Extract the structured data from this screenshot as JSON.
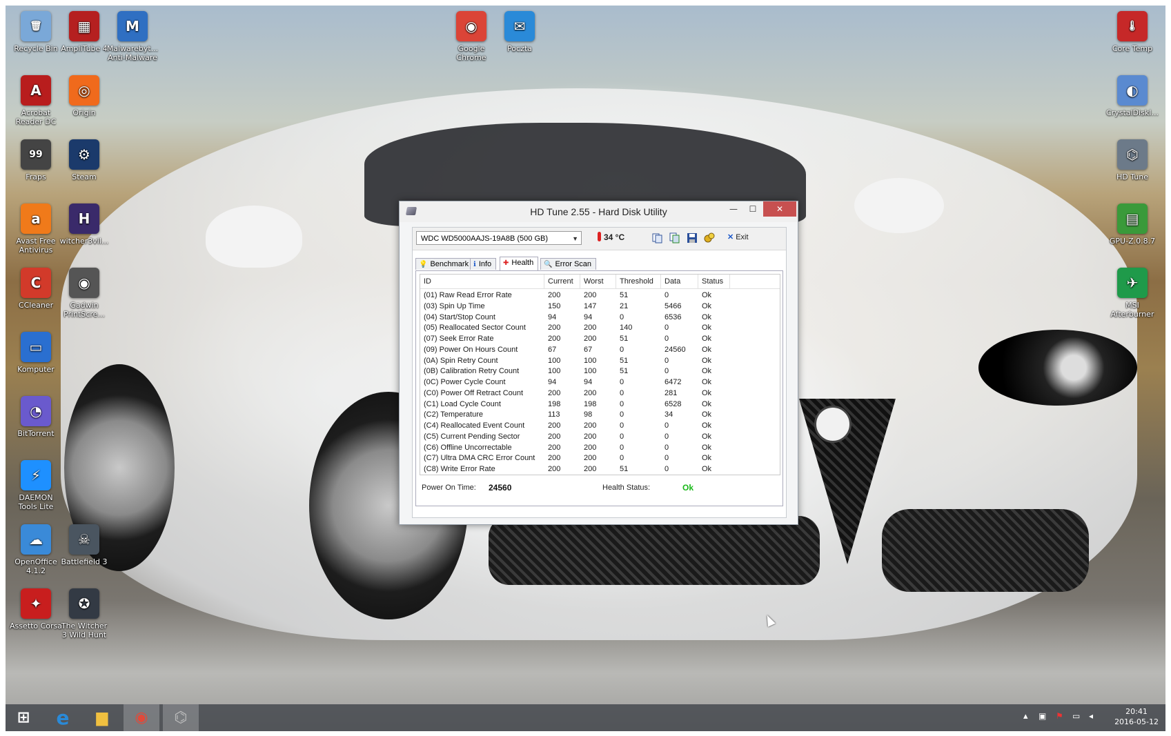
{
  "desktop": {
    "icons_left": [
      {
        "label": "Recycle Bin",
        "icon": "recycle-bin-icon",
        "color": "#7aa8d8",
        "glyph": "🗑"
      },
      {
        "label": "AmpliTube 4",
        "icon": "amplitube-icon",
        "color": "#b52020",
        "glyph": "▦"
      },
      {
        "label": "Malwarebyt... Anti-Malware",
        "icon": "malwarebytes-icon",
        "color": "#2f6fc2",
        "glyph": "M"
      },
      {
        "label": "Acrobat Reader DC",
        "icon": "acrobat-icon",
        "color": "#b81d1d",
        "glyph": "A"
      },
      {
        "label": "Origin",
        "icon": "origin-icon",
        "color": "#f06a1c",
        "glyph": "◎"
      },
      {
        "label": "Fraps",
        "icon": "fraps-icon",
        "color": "#444444",
        "glyph": "99"
      },
      {
        "label": "Steam",
        "icon": "steam-icon",
        "color": "#1b3a6b",
        "glyph": "⚙"
      },
      {
        "label": "Avast Free Antivirus",
        "icon": "avast-icon",
        "color": "#f07a1a",
        "glyph": "a"
      },
      {
        "label": "witcher3vil...",
        "icon": "witcher-hoc-icon",
        "color": "#3a2a6a",
        "glyph": "H"
      },
      {
        "label": "CCleaner",
        "icon": "ccleaner-icon",
        "color": "#d23a2a",
        "glyph": "C"
      },
      {
        "label": "Gadwin PrintScre...",
        "icon": "camera-icon",
        "color": "#555555",
        "glyph": "◉"
      },
      {
        "label": "Komputer",
        "icon": "computer-icon",
        "color": "#2a6fd0",
        "glyph": "▭"
      },
      {
        "label": "BitTorrent",
        "icon": "bittorrent-icon",
        "color": "#6a5acd",
        "glyph": "◔"
      },
      {
        "label": "DAEMON Tools Lite",
        "icon": "daemon-tools-icon",
        "color": "#1e90ff",
        "glyph": "⚡"
      },
      {
        "label": "OpenOffice 4.1.2",
        "icon": "openoffice-icon",
        "color": "#3a8ad8",
        "glyph": "☁"
      },
      {
        "label": "Battlefield 3",
        "icon": "battlefield-icon",
        "color": "#4a5560",
        "glyph": "☠"
      },
      {
        "label": "Assetto Corsa",
        "icon": "assetto-corsa-icon",
        "color": "#c81e1e",
        "glyph": "✦"
      },
      {
        "label": "The Witcher 3 Wild Hunt",
        "icon": "witcher-icon",
        "color": "#333a44",
        "glyph": "✪"
      }
    ],
    "icons_top": [
      {
        "label": "Google Chrome",
        "icon": "chrome-icon",
        "color": "#db4437",
        "glyph": "◉"
      },
      {
        "label": "Poczta",
        "icon": "mail-icon",
        "color": "#2a8ad8",
        "glyph": "✉"
      }
    ],
    "icons_right": [
      {
        "label": "Core Temp",
        "icon": "core-temp-icon",
        "color": "#c62828",
        "glyph": "🌡"
      },
      {
        "label": "CrystalDiskI...",
        "icon": "crystaldiskinfo-icon",
        "color": "#5a8ad0",
        "glyph": "◐"
      },
      {
        "label": "HD Tune",
        "icon": "hd-tune-icon",
        "color": "#6c7a89",
        "glyph": "⌬"
      },
      {
        "label": "GPU-Z.0.8.7",
        "icon": "gpu-z-icon",
        "color": "#3a9a3a",
        "glyph": "▤"
      },
      {
        "label": "MSI Afterburner",
        "icon": "msi-afterburner-icon",
        "color": "#1f9a4a",
        "glyph": "✈"
      }
    ]
  },
  "window": {
    "title": "HD Tune 2.55 - Hard Disk Utility",
    "drive": "WDC    WD5000AAJS-19A8B (500 GB)",
    "temperature": "34 °C",
    "exit_label": "Exit",
    "tabs": [
      {
        "label": "Benchmark",
        "icon": "benchmark-icon",
        "glyph": "💡"
      },
      {
        "label": "Info",
        "icon": "info-icon",
        "glyph": "ℹ"
      },
      {
        "label": "Health",
        "icon": "health-icon",
        "glyph": "✚"
      },
      {
        "label": "Error Scan",
        "icon": "error-scan-icon",
        "glyph": "🔍"
      }
    ],
    "selected_tab": "Health",
    "columns": [
      "ID",
      "Current",
      "Worst",
      "Threshold",
      "Data",
      "Status"
    ],
    "rows": [
      [
        "(01) Raw Read Error Rate",
        "200",
        "200",
        "51",
        "0",
        "Ok"
      ],
      [
        "(03) Spin Up Time",
        "150",
        "147",
        "21",
        "5466",
        "Ok"
      ],
      [
        "(04) Start/Stop Count",
        "94",
        "94",
        "0",
        "6536",
        "Ok"
      ],
      [
        "(05) Reallocated Sector Count",
        "200",
        "200",
        "140",
        "0",
        "Ok"
      ],
      [
        "(07) Seek Error Rate",
        "200",
        "200",
        "51",
        "0",
        "Ok"
      ],
      [
        "(09) Power On Hours Count",
        "67",
        "67",
        "0",
        "24560",
        "Ok"
      ],
      [
        "(0A) Spin Retry Count",
        "100",
        "100",
        "51",
        "0",
        "Ok"
      ],
      [
        "(0B) Calibration Retry Count",
        "100",
        "100",
        "51",
        "0",
        "Ok"
      ],
      [
        "(0C) Power Cycle Count",
        "94",
        "94",
        "0",
        "6472",
        "Ok"
      ],
      [
        "(C0) Power Off Retract Count",
        "200",
        "200",
        "0",
        "281",
        "Ok"
      ],
      [
        "(C1) Load Cycle Count",
        "198",
        "198",
        "0",
        "6528",
        "Ok"
      ],
      [
        "(C2) Temperature",
        "113",
        "98",
        "0",
        "34",
        "Ok"
      ],
      [
        "(C4) Reallocated Event Count",
        "200",
        "200",
        "0",
        "0",
        "Ok"
      ],
      [
        "(C5) Current Pending Sector",
        "200",
        "200",
        "0",
        "0",
        "Ok"
      ],
      [
        "(C6) Offline Uncorrectable",
        "200",
        "200",
        "0",
        "0",
        "Ok"
      ],
      [
        "(C7) Ultra DMA CRC Error Count",
        "200",
        "200",
        "0",
        "0",
        "Ok"
      ],
      [
        "(C8) Write Error Rate",
        "200",
        "200",
        "51",
        "0",
        "Ok"
      ]
    ],
    "power_on_time_label": "Power On Time:",
    "power_on_time_value": "24560",
    "health_status_label": "Health Status:",
    "health_status_value": "Ok",
    "ok_color": "#18b818"
  },
  "taskbar": {
    "clock_time": "20:41",
    "clock_date": "2016-05-12",
    "apps": [
      {
        "name": "start-button",
        "glyph": "⊞"
      },
      {
        "name": "internet-explorer-icon",
        "glyph": "e"
      },
      {
        "name": "file-explorer-icon",
        "glyph": "▆"
      },
      {
        "name": "chrome-taskbar-icon",
        "glyph": "◉"
      },
      {
        "name": "hd-tune-taskbar-icon",
        "glyph": "⌬"
      }
    ]
  }
}
